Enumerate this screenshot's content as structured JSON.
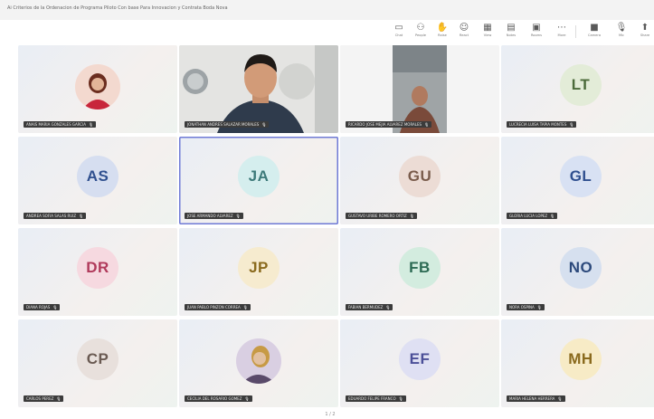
{
  "window": {
    "title": "Ai Criterios de la Ordenacion de Programa Piloto Con base Para Innovacion y Contrata Boda Nova"
  },
  "toolbar": {
    "buttons": [
      {
        "name": "chat-button",
        "icon": "chat-icon",
        "glyph": "▭",
        "label": "Chat"
      },
      {
        "name": "people-button",
        "icon": "people-icon",
        "glyph": "⚇",
        "label": "People"
      },
      {
        "name": "raise-button",
        "icon": "raise-hand-icon",
        "glyph": "✋",
        "label": "Raise"
      },
      {
        "name": "react-button",
        "icon": "react-icon",
        "glyph": "☺",
        "label": "React"
      },
      {
        "name": "view-button",
        "icon": "view-icon",
        "glyph": "▦",
        "label": "View"
      },
      {
        "name": "notes-button",
        "icon": "notes-icon",
        "glyph": "▤",
        "label": "Notes"
      },
      {
        "name": "rooms-button",
        "icon": "rooms-icon",
        "glyph": "▣",
        "label": "Rooms"
      },
      {
        "name": "more-button",
        "icon": "more-icon",
        "glyph": "⋯",
        "label": "More"
      },
      {
        "name": "camera-button",
        "icon": "camera-icon",
        "glyph": "■",
        "label": "Camera"
      },
      {
        "name": "mic-button",
        "icon": "mic-icon",
        "glyph": "🎙",
        "label": "Mic"
      },
      {
        "name": "share-button",
        "icon": "share-icon",
        "glyph": "⬆",
        "label": "Share"
      }
    ]
  },
  "tiles": [
    {
      "kind": "photo",
      "initials": "",
      "name": "ANAIS MARIA GONZALES GARCIA",
      "color": "#c8263b",
      "bg": "#fde1e6"
    },
    {
      "kind": "video",
      "initials": "",
      "name": "JONATHAN ANDRES SALAZAR MORALES",
      "color": "#333",
      "bg": "#d8d8d8"
    },
    {
      "kind": "video2",
      "initials": "",
      "name": "RICARDO JOSE MEJIA ALVAREZ MORALES",
      "color": "#333",
      "bg": "#cfcfcf"
    },
    {
      "kind": "initials",
      "initials": "LT",
      "name": "LUCRECIA LUISA TAPIA MONTES",
      "color": "#4b6a3a",
      "bg": "#e3ecd8"
    },
    {
      "kind": "initials",
      "initials": "AS",
      "name": "ANDREA SOFIA SALAS RUIZ",
      "color": "#30508f",
      "bg": "#d6def0"
    },
    {
      "kind": "initials",
      "initials": "JA",
      "name": "JOSE ARMANDO ALVAREZ",
      "color": "#3d7a7a",
      "bg": "#d5eeee"
    },
    {
      "kind": "initials",
      "initials": "GU",
      "name": "GUSTAVO URIBE ROMERO ORTIZ",
      "color": "#7a5c4c",
      "bg": "#ecdcd5"
    },
    {
      "kind": "initials",
      "initials": "GL",
      "name": "GLORIA LUCIA LOPEZ",
      "color": "#2f4f8f",
      "bg": "#d8e1f3"
    },
    {
      "kind": "initials",
      "initials": "DR",
      "name": "DIANA ROJAS",
      "color": "#b03a5b",
      "bg": "#f6d9e0"
    },
    {
      "kind": "initials",
      "initials": "JP",
      "name": "JUAN PABLO PINZON CORREA",
      "color": "#8a6a1d",
      "bg": "#f6ebcf"
    },
    {
      "kind": "initials",
      "initials": "FB",
      "name": "FABIAN BERMUDEZ",
      "color": "#2d6b54",
      "bg": "#d3ecdf"
    },
    {
      "kind": "initials",
      "initials": "NO",
      "name": "NORA OSPINA",
      "color": "#2d4a7c",
      "bg": "#d6e0ef"
    },
    {
      "kind": "initials",
      "initials": "CP",
      "name": "CARLOS PEREZ",
      "color": "#6a5a52",
      "bg": "#e8e0dc"
    },
    {
      "kind": "photo2",
      "initials": "",
      "name": "CECILIA DEL ROSARIO GOMEZ",
      "color": "#7a5a9a",
      "bg": "#eadcf1"
    },
    {
      "kind": "initials",
      "initials": "EF",
      "name": "EDUARDO FELIPE FRANCO",
      "color": "#4b4f98",
      "bg": "#dfe0f3"
    },
    {
      "kind": "initials",
      "initials": "MH",
      "name": "MARIA HELENA HERRERA",
      "color": "#8a6a1d",
      "bg": "#f7ebc6"
    }
  ],
  "pager": {
    "text": "1 / 2"
  }
}
